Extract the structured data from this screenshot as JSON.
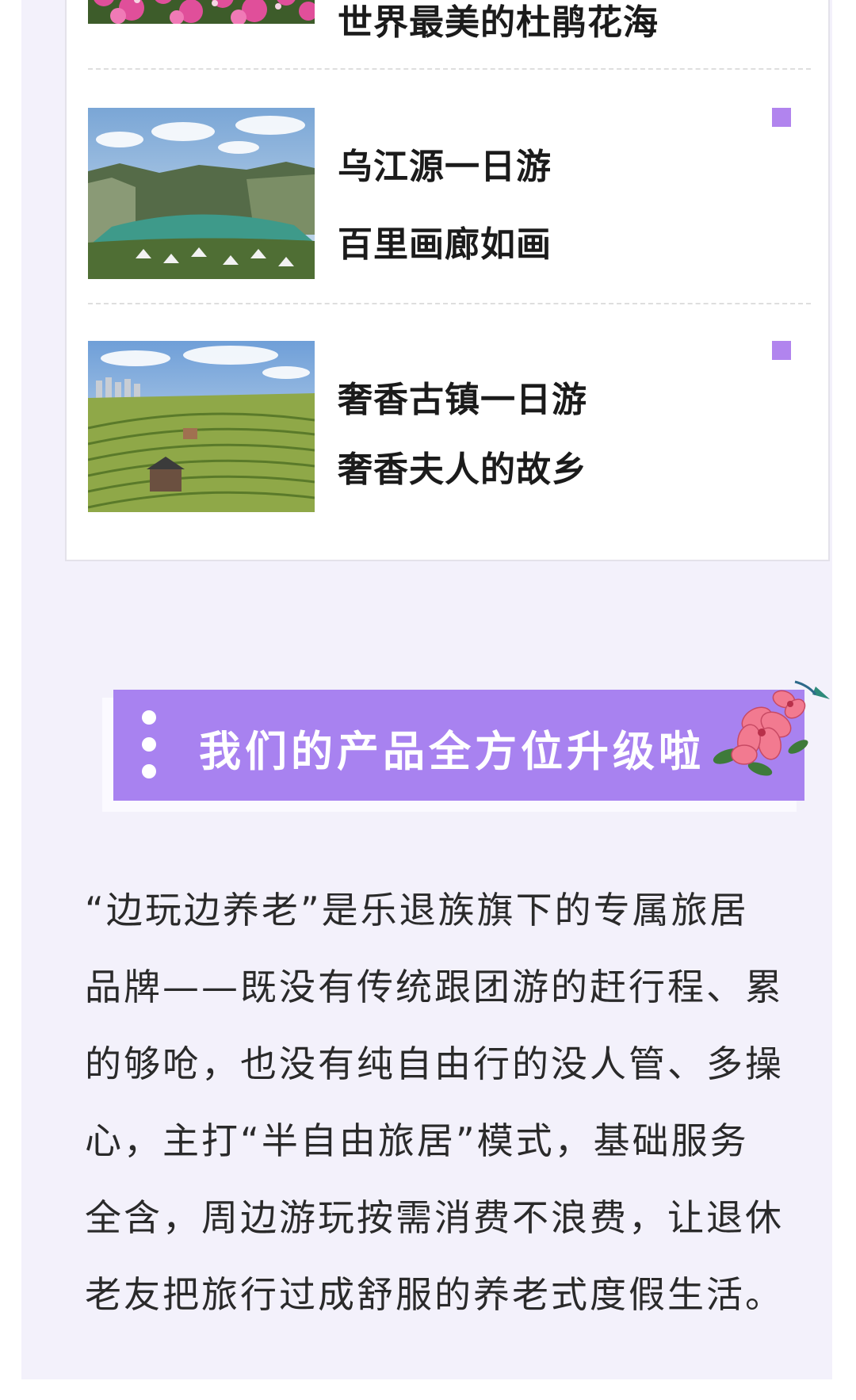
{
  "routes": [
    {
      "line1": "",
      "line2": "世界最美的杜鹃花海",
      "image": "azalea-field-photo"
    },
    {
      "line1": "乌江源一日游",
      "line2": "百里画廊如画",
      "image": "wujiang-canyon-photo"
    },
    {
      "line1": "奢香古镇一日游",
      "line2": "奢香夫人的故乡",
      "image": "tea-terraces-photo"
    }
  ],
  "banner": {
    "title": "我们的产品全方位升级啦",
    "decoration": "azalea-flower-icon"
  },
  "description": {
    "lines": [
      "“边玩边养老”是乐退族旗下的专属旅居",
      "品牌——既没有传统跟团游的赶行程、累",
      "的够呛，也没有纯自由行的没人管、多操",
      "心，主打“半自由旅居”模式，基础服务",
      "全含，周边游玩按需消费不浪费，让退休",
      "老友把旅行过成舒服的养老式度假生活。"
    ]
  },
  "colors": {
    "accent": "#a882f0",
    "marker": "#b184ee",
    "background": "#f3f1fb"
  }
}
